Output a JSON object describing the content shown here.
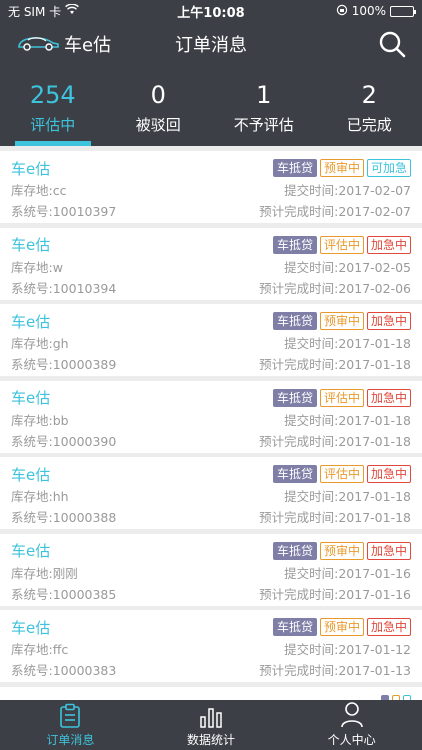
{
  "status_bar": {
    "carrier": "无 SIM 卡",
    "time": "上午10:08",
    "battery": "100%",
    "icons": [
      "wifi-icon",
      "lock-rotation-icon",
      "battery-icon"
    ]
  },
  "header": {
    "brand": "车e估",
    "title": "订单消息",
    "icons": [
      "car-logo-icon",
      "search-icon"
    ]
  },
  "stats": [
    {
      "count": "254",
      "label": "评估中"
    },
    {
      "count": "0",
      "label": "被驳回"
    },
    {
      "count": "1",
      "label": "不予评估"
    },
    {
      "count": "2",
      "label": "已完成"
    }
  ],
  "active_stat": 0,
  "list": {
    "location_prefix": "库存地:",
    "system_prefix": "系统号:",
    "submit_prefix": "提交时间:",
    "expected_prefix": "预计完成时间:",
    "items": [
      {
        "name": "车e估",
        "location": "cc",
        "system_no": "10010397",
        "submit_time": "2017-02-07",
        "expected_time": "2017-02-07",
        "tags": [
          {
            "text": "车抵贷",
            "style": "solid"
          },
          {
            "text": "预审中",
            "style": "orange"
          },
          {
            "text": "可加急",
            "style": "cyan"
          }
        ]
      },
      {
        "name": "车e估",
        "location": "w",
        "system_no": "10010394",
        "submit_time": "2017-02-05",
        "expected_time": "2017-02-06",
        "tags": [
          {
            "text": "车抵贷",
            "style": "solid"
          },
          {
            "text": "评估中",
            "style": "orange"
          },
          {
            "text": "加急中",
            "style": "red"
          }
        ]
      },
      {
        "name": "车e估",
        "location": "gh",
        "system_no": "10000389",
        "submit_time": "2017-01-18",
        "expected_time": "2017-01-18",
        "tags": [
          {
            "text": "车抵贷",
            "style": "solid"
          },
          {
            "text": "预审中",
            "style": "orange"
          },
          {
            "text": "加急中",
            "style": "red"
          }
        ]
      },
      {
        "name": "车e估",
        "location": "bb",
        "system_no": "10000390",
        "submit_time": "2017-01-18",
        "expected_time": "2017-01-18",
        "tags": [
          {
            "text": "车抵贷",
            "style": "solid"
          },
          {
            "text": "评估中",
            "style": "orange"
          },
          {
            "text": "加急中",
            "style": "red"
          }
        ]
      },
      {
        "name": "车e估",
        "location": "hh",
        "system_no": "10000388",
        "submit_time": "2017-01-18",
        "expected_time": "2017-01-18",
        "tags": [
          {
            "text": "车抵贷",
            "style": "solid"
          },
          {
            "text": "评估中",
            "style": "orange"
          },
          {
            "text": "加急中",
            "style": "red"
          }
        ]
      },
      {
        "name": "车e估",
        "location": "刚刚",
        "system_no": "10000385",
        "submit_time": "2017-01-16",
        "expected_time": "2017-01-16",
        "tags": [
          {
            "text": "车抵贷",
            "style": "solid"
          },
          {
            "text": "预审中",
            "style": "orange"
          },
          {
            "text": "加急中",
            "style": "red"
          }
        ]
      },
      {
        "name": "车e估",
        "location": "ffc",
        "system_no": "10000383",
        "submit_time": "2017-01-12",
        "expected_time": "2017-01-13",
        "tags": [
          {
            "text": "车抵贷",
            "style": "solid"
          },
          {
            "text": "预审中",
            "style": "orange"
          },
          {
            "text": "加急中",
            "style": "red"
          }
        ]
      },
      {
        "name": "",
        "location": "",
        "system_no": "",
        "submit_time": "",
        "expected_time": "",
        "tags": [
          {
            "text": "",
            "style": "solid"
          },
          {
            "text": "",
            "style": "orange"
          },
          {
            "text": "",
            "style": "cyan"
          }
        ]
      }
    ]
  },
  "tabbar": {
    "tabs": [
      {
        "label": "订单消息",
        "icon": "clipboard-icon"
      },
      {
        "label": "数据统计",
        "icon": "bar-chart-icon"
      },
      {
        "label": "个人中心",
        "icon": "user-icon"
      }
    ],
    "active": 0
  },
  "colors": {
    "accent": "#3ec3dc",
    "dark": "#3c3f46",
    "tag_purple": "#7e7ea6",
    "tag_orange": "#e99a2c",
    "tag_red": "#e0483b"
  }
}
